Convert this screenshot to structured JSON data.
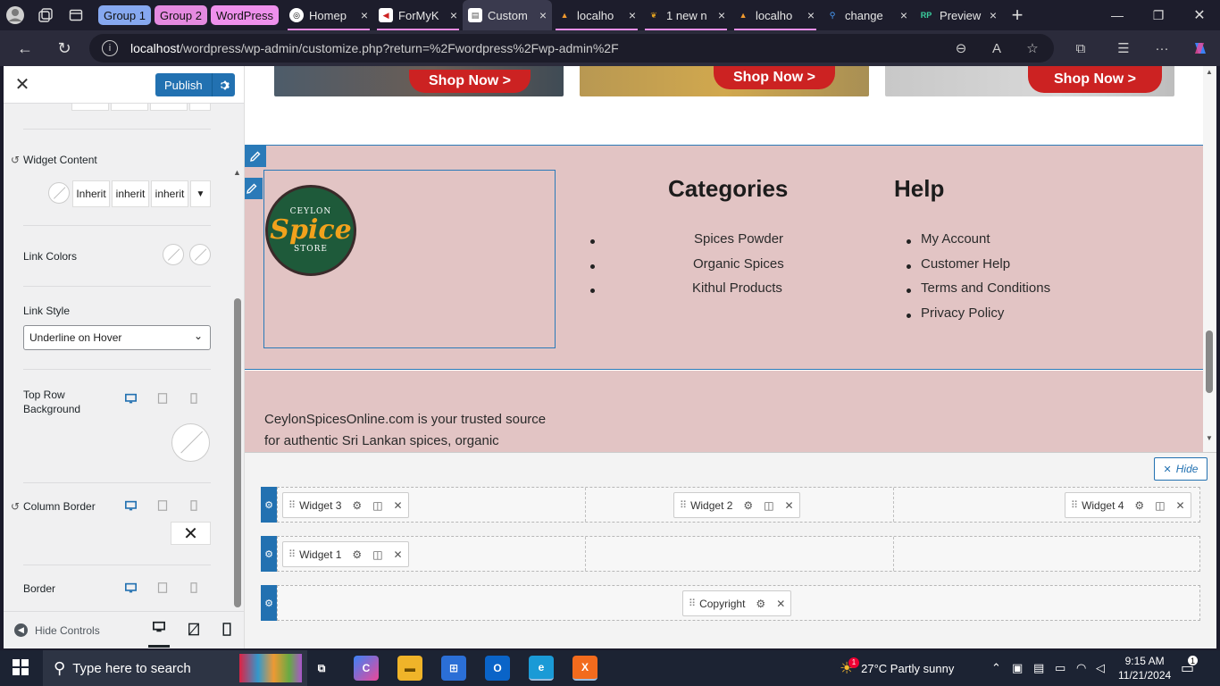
{
  "browser": {
    "tab_groups": [
      {
        "label": "Group 1",
        "color": "#86a8f0"
      },
      {
        "label": "Group 2",
        "color": "#e58ae0"
      },
      {
        "label": "WordPress",
        "color": "#ee90ec"
      }
    ],
    "tabs": [
      {
        "label": "Homep",
        "icon": "openai-icon",
        "active": false
      },
      {
        "label": "ForMyK",
        "icon": "formyk-icon",
        "active": false
      },
      {
        "label": "Custom",
        "icon": "doc-icon",
        "active": true
      },
      {
        "label": "localho",
        "icon": "xampp-icon",
        "active": false
      },
      {
        "label": "1 new n",
        "icon": "leaf-icon",
        "active": false
      },
      {
        "label": "localho",
        "icon": "xampp-icon",
        "active": false
      },
      {
        "label": "change",
        "icon": "search-icon",
        "active": false
      },
      {
        "label": "Preview",
        "icon": "rp-icon",
        "active": false
      }
    ],
    "url_host": "localhost",
    "url_path": "/wordpress/wp-admin/customize.php?return=%2Fwordpress%2Fwp-admin%2F"
  },
  "customizer": {
    "publish_label": "Publish",
    "sections": {
      "widget_content": {
        "label": "Widget Content",
        "fields": [
          "Inherit",
          "inherit",
          "inherit"
        ]
      },
      "link_colors": {
        "label": "Link Colors"
      },
      "link_style": {
        "label": "Link Style",
        "value": "Underline on Hover"
      },
      "top_row_background": {
        "label": "Top Row Background"
      },
      "column_border": {
        "label": "Column Border"
      },
      "border": {
        "label": "Border"
      }
    },
    "hide_controls_label": "Hide Controls"
  },
  "preview": {
    "promo_buttons": [
      "Shop Now >",
      "Shop Now >",
      "Shop Now >"
    ],
    "logo": {
      "top": "CEYLON",
      "main": "Spice",
      "bottom": "STORE"
    },
    "categories": {
      "heading": "Categories",
      "items": [
        "Spices Powder",
        "Organic Spices",
        "Kithul Products"
      ]
    },
    "help": {
      "heading": "Help",
      "items": [
        "My Account",
        "Customer Help",
        "Terms and Conditions",
        "Privacy Policy"
      ]
    },
    "about_line1": "CeylonSpicesOnline.com is your trusted source",
    "about_line2": "for authentic Sri Lankan spices, organic"
  },
  "footer_builder": {
    "hide_label": "Hide",
    "rows": [
      {
        "chips": [
          "Widget 3",
          "Widget 2",
          "Widget 4"
        ]
      },
      {
        "chips": [
          "Widget 1"
        ]
      },
      {
        "chips": [
          "Copyright"
        ]
      }
    ]
  },
  "taskbar": {
    "search_placeholder": "Type here to search",
    "weather": "27°C  Partly sunny",
    "weather_badge": "1",
    "time": "9:15 AM",
    "date": "11/21/2024",
    "notification_count": "1"
  },
  "colors": {
    "accent": "#2271b1",
    "footer_bg": "#e2c4c4",
    "shop_button": "#cc2222"
  }
}
